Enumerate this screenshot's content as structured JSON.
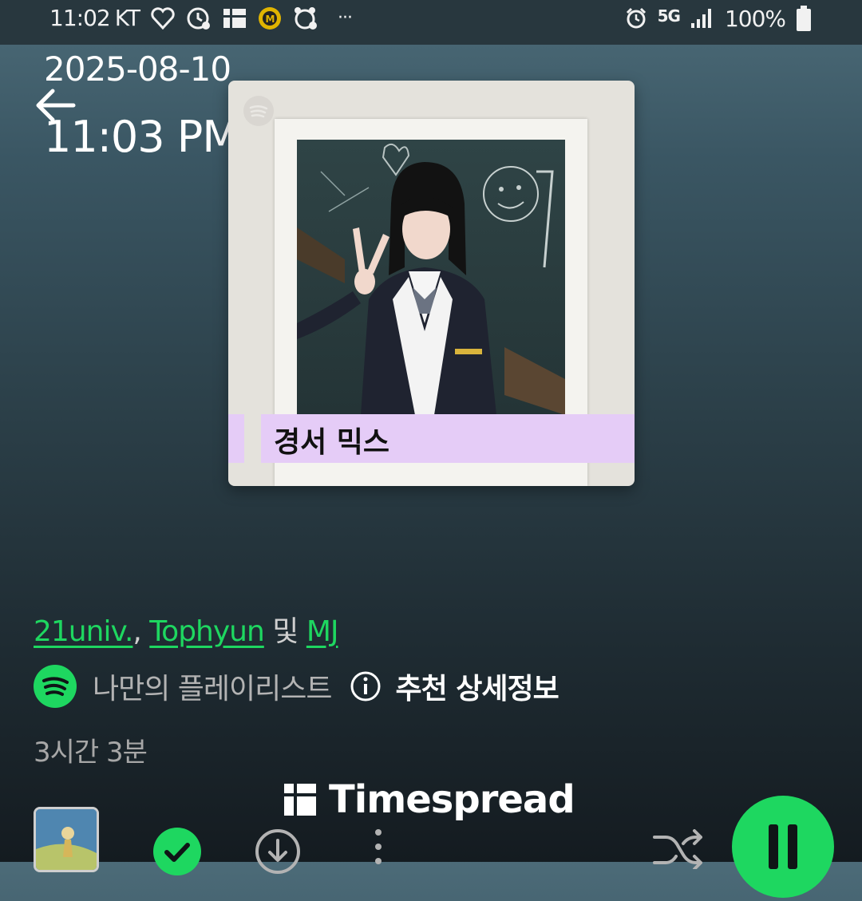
{
  "status_bar": {
    "time": "11:02",
    "carrier": "KT",
    "more": "···",
    "network": "5G",
    "battery": "100%"
  },
  "overlay": {
    "date": "2025-08-10",
    "time": "11:03 PM"
  },
  "playlist": {
    "cover_title": "경서 믹스",
    "artists": [
      "21univ.",
      "Tophyun",
      "MJ"
    ],
    "artist_sep": ", ",
    "artist_and": " 및 ",
    "owner": "나만의 플레이리스트",
    "recommendation_label": "추천 상세정보",
    "duration": "3시간 3분"
  },
  "watermark": {
    "text": "Timespread"
  },
  "controls": {
    "saved": true,
    "playing": true
  },
  "colors": {
    "accent": "#1ed760",
    "cover_label_bg": "#e5ccf7"
  },
  "icons": [
    "heart-status-icon",
    "clock-status-icon",
    "app-status-icon",
    "m-badge-icon",
    "alarm-app-icon",
    "alarm-icon",
    "signal-icon",
    "battery-icon",
    "back-arrow-icon",
    "spotify-icon",
    "info-icon",
    "check-icon",
    "download-icon",
    "more-icon",
    "shuffle-icon",
    "pause-icon"
  ]
}
